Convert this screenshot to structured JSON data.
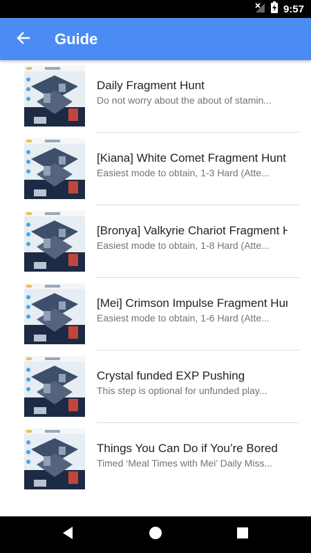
{
  "status_bar": {
    "time": "9:57"
  },
  "app_bar": {
    "title": "Guide",
    "back_icon": "arrow-back-icon"
  },
  "guide_items": [
    {
      "title": "Daily Fragment Hunt",
      "subtitle": "Do not worry about the about of stamin..."
    },
    {
      "title": "[Kiana] White Comet Fragment Hunt",
      "subtitle": "Easiest mode to obtain, 1-3 Hard (Atte..."
    },
    {
      "title": "[Bronya] Valkyrie Chariot Fragment Hunt",
      "subtitle": "Easiest mode to obtain, 1-8 Hard (Atte..."
    },
    {
      "title": "[Mei] Crimson Impulse Fragment Hunt",
      "subtitle": "Easiest mode to obtain, 1-6 Hard (Atte..."
    },
    {
      "title": "Crystal funded EXP Pushing",
      "subtitle": "This step is optional for unfunded play..."
    },
    {
      "title": "Things You Can Do if You’re Bored",
      "subtitle": "Timed ‘Meal Times with Mei’ Daily Miss..."
    }
  ],
  "nav_bar": {
    "icons": [
      "nav-back-icon",
      "home-icon",
      "recents-icon"
    ]
  },
  "colors": {
    "app_bar": "#4a8cf4",
    "status_bar": "#000000",
    "nav_bar": "#000000"
  }
}
